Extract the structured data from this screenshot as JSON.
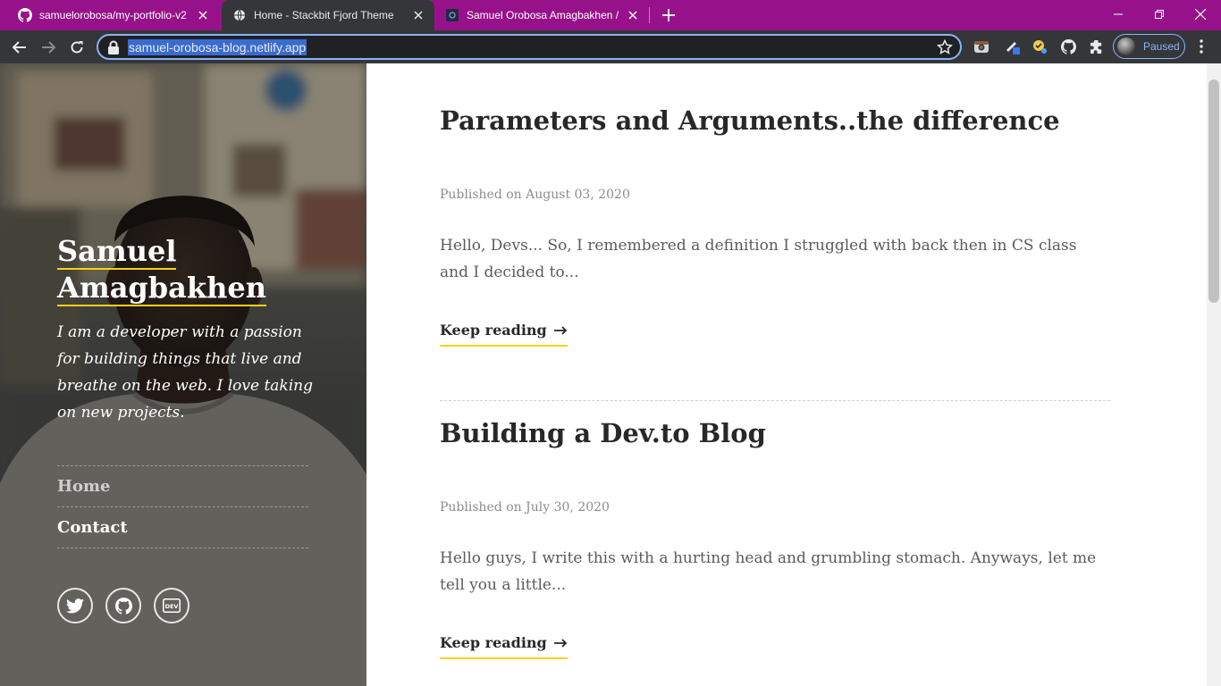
{
  "browser": {
    "tabs": [
      {
        "title": "samuelorobosa/my-portfolio-v2",
        "icon": "github-icon",
        "active": false
      },
      {
        "title": "Home - Stackbit Fjord Theme",
        "icon": "globe-icon",
        "active": true
      },
      {
        "title": "Samuel Orobosa Amagbakhen / ",
        "icon": "dev-favicon-icon",
        "active": false
      }
    ],
    "url": "samuel-orobosa-blog.netlify.app",
    "profile_status": "Paused",
    "tabstrip_color": "#97128a"
  },
  "sidebar": {
    "title_line1": "Samuel",
    "title_line2": "Amagbakhen",
    "description": "I am a developer with a passion for building things that live and breathe on the web. I love taking on new projects.",
    "nav": [
      {
        "label": "Home"
      },
      {
        "label": "Contact"
      }
    ],
    "social": [
      "twitter-icon",
      "github-icon",
      "dev-icon"
    ],
    "dev_text": "DEV"
  },
  "posts": [
    {
      "title": "Parameters and Arguments..the difference",
      "date": "Published on August 03, 2020",
      "excerpt": "Hello, Devs... So, I remembered a definition I struggled with back then in CS class and I decided to...",
      "link_label": "Keep reading"
    },
    {
      "title": "Building a Dev.to Blog",
      "date": "Published on July 30, 2020",
      "excerpt": "Hello guys, I write this with a hurting head and grumbling stomach. Anyways, let me tell you a little...",
      "link_label": "Keep reading"
    }
  ],
  "colors": {
    "accent": "#ffd012",
    "heading": "#282828",
    "text": "#5b5b5b",
    "meta": "#8c8c8c"
  }
}
